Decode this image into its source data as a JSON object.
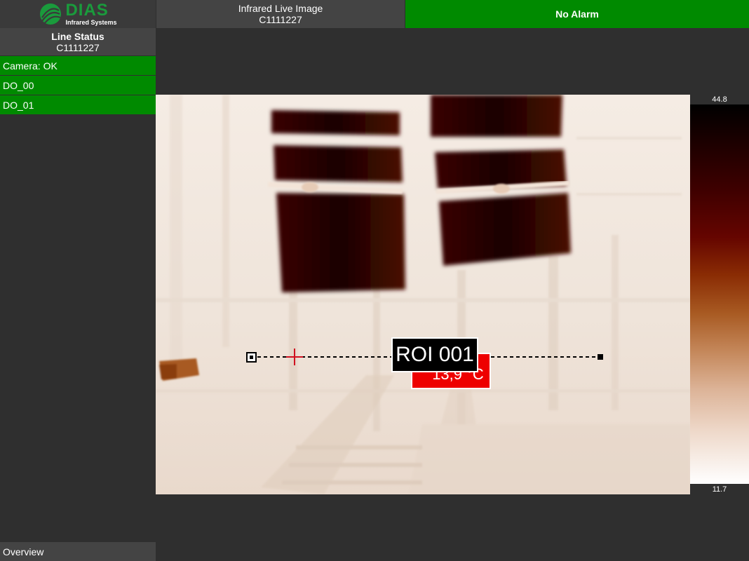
{
  "header": {
    "logo": {
      "brand": "DIAS",
      "subtitle": "Infrared Systems",
      "icon": "dias-leaf-logo"
    },
    "view_title": "Infrared Live Image",
    "view_id": "C1111227",
    "alarm_status": "No Alarm"
  },
  "sidebar": {
    "line_status_title": "Line Status",
    "line_status_id": "C1111227",
    "items": [
      {
        "label": "Camera: OK"
      },
      {
        "label": "DO_00"
      },
      {
        "label": "DO_01"
      }
    ],
    "footer_label": "Overview"
  },
  "thermal_view": {
    "roi": {
      "name": "ROI 001",
      "temperature": "13,9 °C"
    },
    "scale": {
      "max": "44.8",
      "min": "11.7"
    }
  },
  "colors": {
    "alarm_ok": "#008a00",
    "alarm_box": "#ee0000",
    "brand": "#1a9b3c"
  }
}
